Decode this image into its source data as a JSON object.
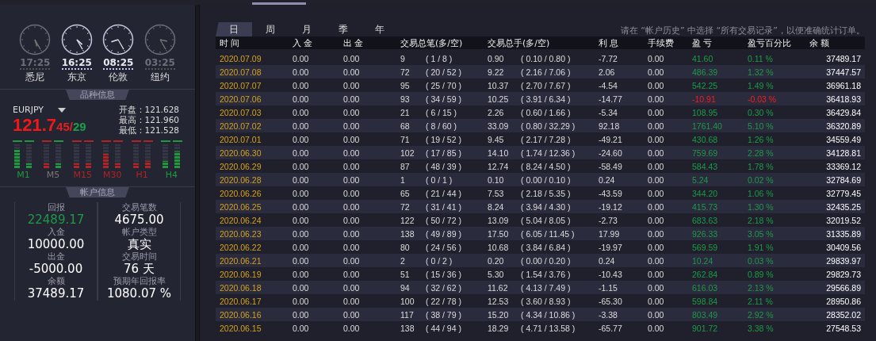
{
  "clocks": [
    {
      "time": "17:25",
      "city": "悉尼",
      "active": false
    },
    {
      "time": "16:25",
      "city": "东京",
      "active": true
    },
    {
      "time": "08:25",
      "city": "伦敦",
      "active": true
    },
    {
      "time": "03:25",
      "city": "纽约",
      "active": false
    }
  ],
  "symbol_panel": {
    "title": "品种信息",
    "symbol": "EURJPY",
    "price_big": "121.7",
    "bid_pips": "45",
    "separator": "/",
    "ask_pips": "29",
    "stats": [
      {
        "label": "开盘：",
        "value": "121.628"
      },
      {
        "label": "最高：",
        "value": "121.960"
      },
      {
        "label": "最低：",
        "value": "121.528"
      }
    ],
    "timeframes": [
      {
        "label": "M1",
        "color": "#1e9a3c",
        "bars": [
          {
            "level": 0.8,
            "color": "#1e9a3c"
          },
          {
            "level": 0.2,
            "color": "#1e9a3c"
          }
        ]
      },
      {
        "label": "M5",
        "color": "#777777",
        "bars": [
          {
            "level": 0.2,
            "color": "#b02424"
          },
          {
            "level": 0.2,
            "color": "#1e9a3c"
          }
        ]
      },
      {
        "label": "M15",
        "color": "#b02424",
        "bars": [
          {
            "level": 0.2,
            "color": "#b02424"
          },
          {
            "level": 0.2,
            "color": "#b02424"
          }
        ]
      },
      {
        "label": "M30",
        "color": "#b02424",
        "bars": [
          {
            "level": 0.6,
            "color": "#b02424"
          },
          {
            "level": 0.2,
            "color": "#b02424"
          }
        ]
      },
      {
        "label": "H1",
        "color": "#b02424",
        "bars": [
          {
            "level": 0.2,
            "color": "#b02424"
          },
          {
            "level": 0.3,
            "color": "#b02424"
          }
        ]
      },
      {
        "label": "H4",
        "color": "#1e9a3c",
        "bars": [
          {
            "level": 0.3,
            "color": "#1e9a3c"
          },
          {
            "level": 0.7,
            "color": "#1e9a3c"
          }
        ]
      }
    ]
  },
  "account_panel": {
    "title": "帐户信息",
    "left": [
      {
        "label": "回报",
        "value": "22489.17",
        "highlight": true
      },
      {
        "label": "入金",
        "value": "10000.00",
        "highlight": false
      },
      {
        "label": "出金",
        "value": "-5000.00",
        "highlight": false
      },
      {
        "label": "余额",
        "value": "37489.17",
        "highlight": false
      }
    ],
    "right": [
      {
        "label": "交易笔数",
        "value": "4675.00",
        "highlight": false
      },
      {
        "label": "帐户类型",
        "value": "真实",
        "highlight": false
      },
      {
        "label": "交易时间",
        "value": "76 天",
        "highlight": false
      },
      {
        "label": "预期年回报率",
        "value": "1080.07 %",
        "highlight": false
      }
    ]
  },
  "tabs": [
    {
      "label": "日",
      "selected": true
    },
    {
      "label": "周",
      "selected": false
    },
    {
      "label": "月",
      "selected": false
    },
    {
      "label": "季",
      "selected": false
    },
    {
      "label": "年",
      "selected": false
    }
  ],
  "note": "请在 “帐户历史” 中选择 “所有交易记录”，以便准确统计订单。",
  "table": {
    "columns": [
      "时 间",
      "入 金",
      "出 金",
      "交易总笔(多/空)",
      "交易总手(多/空)",
      "利 息",
      "手续费",
      "盈 亏",
      "盈亏百分比",
      "余 额"
    ],
    "rows": [
      {
        "date": "2020.07.09",
        "deposit": "0.00",
        "withdrawal": "0.00",
        "trades": "9",
        "trades_split": "( 1 / 8 )",
        "lots": "0.90",
        "lots_split": "( 0.10 / 0.80 )",
        "interest": "-7.72",
        "fee": "0.00",
        "profit": "41.60",
        "percent": "0.11 %",
        "balance": "37489.17",
        "loss": false
      },
      {
        "date": "2020.07.08",
        "deposit": "0.00",
        "withdrawal": "0.00",
        "trades": "72",
        "trades_split": "( 20 / 52 )",
        "lots": "9.22",
        "lots_split": "( 2.16 / 7.06 )",
        "interest": "2.06",
        "fee": "0.00",
        "profit": "486.39",
        "percent": "1.32 %",
        "balance": "37447.57",
        "loss": false
      },
      {
        "date": "2020.07.07",
        "deposit": "0.00",
        "withdrawal": "0.00",
        "trades": "95",
        "trades_split": "( 25 / 70 )",
        "lots": "10.37",
        "lots_split": "( 2.70 / 7.67 )",
        "interest": "-4.54",
        "fee": "0.00",
        "profit": "542.25",
        "percent": "1.49 %",
        "balance": "36961.18",
        "loss": false
      },
      {
        "date": "2020.07.06",
        "deposit": "0.00",
        "withdrawal": "0.00",
        "trades": "93",
        "trades_split": "( 34 / 59 )",
        "lots": "10.25",
        "lots_split": "( 3.91 / 6.34 )",
        "interest": "-14.77",
        "fee": "0.00",
        "profit": "-10.91",
        "percent": "-0.03 %",
        "balance": "36418.93",
        "loss": true
      },
      {
        "date": "2020.07.03",
        "deposit": "0.00",
        "withdrawal": "0.00",
        "trades": "21",
        "trades_split": "( 6 / 15 )",
        "lots": "2.26",
        "lots_split": "( 0.60 / 1.66 )",
        "interest": "-5.34",
        "fee": "0.00",
        "profit": "108.95",
        "percent": "0.30 %",
        "balance": "36429.84",
        "loss": false
      },
      {
        "date": "2020.07.02",
        "deposit": "0.00",
        "withdrawal": "0.00",
        "trades": "68",
        "trades_split": "( 8 / 60 )",
        "lots": "33.09",
        "lots_split": "( 0.80 / 32.29 )",
        "interest": "92.18",
        "fee": "0.00",
        "profit": "1761.40",
        "percent": "5.10 %",
        "balance": "36320.89",
        "loss": false
      },
      {
        "date": "2020.07.01",
        "deposit": "0.00",
        "withdrawal": "0.00",
        "trades": "71",
        "trades_split": "( 19 / 52 )",
        "lots": "9.45",
        "lots_split": "( 2.17 / 7.28 )",
        "interest": "-49.21",
        "fee": "0.00",
        "profit": "430.68",
        "percent": "1.26 %",
        "balance": "34559.49",
        "loss": false
      },
      {
        "date": "2020.06.30",
        "deposit": "0.00",
        "withdrawal": "0.00",
        "trades": "102",
        "trades_split": "( 17 / 85 )",
        "lots": "14.10",
        "lots_split": "( 1.74 / 12.36 )",
        "interest": "-24.60",
        "fee": "0.00",
        "profit": "759.69",
        "percent": "2.28 %",
        "balance": "34128.81",
        "loss": false
      },
      {
        "date": "2020.06.29",
        "deposit": "0.00",
        "withdrawal": "0.00",
        "trades": "87",
        "trades_split": "( 48 / 39 )",
        "lots": "12.74",
        "lots_split": "( 8.24 / 4.50 )",
        "interest": "-58.49",
        "fee": "0.00",
        "profit": "584.43",
        "percent": "1.78 %",
        "balance": "33369.12",
        "loss": false
      },
      {
        "date": "2020.06.28",
        "deposit": "0.00",
        "withdrawal": "0.00",
        "trades": "1",
        "trades_split": "( 0 / 1 )",
        "lots": "0.10",
        "lots_split": "( 0.00 / 0.10 )",
        "interest": "0.24",
        "fee": "0.00",
        "profit": "5.24",
        "percent": "0.02 %",
        "balance": "32784.69",
        "loss": false
      },
      {
        "date": "2020.06.26",
        "deposit": "0.00",
        "withdrawal": "0.00",
        "trades": "65",
        "trades_split": "( 21 / 44 )",
        "lots": "7.53",
        "lots_split": "( 2.18 / 5.35 )",
        "interest": "-43.59",
        "fee": "0.00",
        "profit": "344.20",
        "percent": "1.06 %",
        "balance": "32779.45",
        "loss": false
      },
      {
        "date": "2020.06.25",
        "deposit": "0.00",
        "withdrawal": "0.00",
        "trades": "72",
        "trades_split": "( 31 / 41 )",
        "lots": "8.24",
        "lots_split": "( 3.94 / 4.30 )",
        "interest": "-19.12",
        "fee": "0.00",
        "profit": "415.73",
        "percent": "1.30 %",
        "balance": "32435.25",
        "loss": false
      },
      {
        "date": "2020.06.24",
        "deposit": "0.00",
        "withdrawal": "0.00",
        "trades": "122",
        "trades_split": "( 50 / 72 )",
        "lots": "13.09",
        "lots_split": "( 5.04 / 8.05 )",
        "interest": "-2.73",
        "fee": "0.00",
        "profit": "683.63",
        "percent": "2.18 %",
        "balance": "32019.52",
        "loss": false
      },
      {
        "date": "2020.06.23",
        "deposit": "0.00",
        "withdrawal": "0.00",
        "trades": "138",
        "trades_split": "( 49 / 89 )",
        "lots": "17.50",
        "lots_split": "( 6.05 / 11.45 )",
        "interest": "17.99",
        "fee": "0.00",
        "profit": "926.33",
        "percent": "3.05 %",
        "balance": "31335.89",
        "loss": false
      },
      {
        "date": "2020.06.22",
        "deposit": "0.00",
        "withdrawal": "0.00",
        "trades": "80",
        "trades_split": "( 24 / 56 )",
        "lots": "10.68",
        "lots_split": "( 3.84 / 6.84 )",
        "interest": "-19.97",
        "fee": "0.00",
        "profit": "569.59",
        "percent": "1.91 %",
        "balance": "30409.56",
        "loss": false
      },
      {
        "date": "2020.06.21",
        "deposit": "0.00",
        "withdrawal": "0.00",
        "trades": "2",
        "trades_split": "( 0 / 2 )",
        "lots": "0.20",
        "lots_split": "( 0.00 / 0.20 )",
        "interest": "0.24",
        "fee": "0.00",
        "profit": "10.24",
        "percent": "0.03 %",
        "balance": "29839.97",
        "loss": false
      },
      {
        "date": "2020.06.19",
        "deposit": "0.00",
        "withdrawal": "0.00",
        "trades": "51",
        "trades_split": "( 15 / 36 )",
        "lots": "5.30",
        "lots_split": "( 1.54 / 3.76 )",
        "interest": "-10.43",
        "fee": "0.00",
        "profit": "262.84",
        "percent": "0.89 %",
        "balance": "29829.73",
        "loss": false
      },
      {
        "date": "2020.06.18",
        "deposit": "0.00",
        "withdrawal": "0.00",
        "trades": "94",
        "trades_split": "( 32 / 62 )",
        "lots": "11.62",
        "lots_split": "( 4.13 / 7.49 )",
        "interest": "-1.15",
        "fee": "0.00",
        "profit": "616.03",
        "percent": "2.13 %",
        "balance": "29566.89",
        "loss": false
      },
      {
        "date": "2020.06.17",
        "deposit": "0.00",
        "withdrawal": "0.00",
        "trades": "100",
        "trades_split": "( 22 / 78 )",
        "lots": "12.53",
        "lots_split": "( 3.60 / 8.93 )",
        "interest": "-65.30",
        "fee": "0.00",
        "profit": "598.84",
        "percent": "2.11 %",
        "balance": "28950.86",
        "loss": false
      },
      {
        "date": "2020.06.16",
        "deposit": "0.00",
        "withdrawal": "0.00",
        "trades": "117",
        "trades_split": "( 38 / 79 )",
        "lots": "15.20",
        "lots_split": "( 4.34 / 10.86 )",
        "interest": "-3.38",
        "fee": "0.00",
        "profit": "803.49",
        "percent": "2.92 %",
        "balance": "28352.02",
        "loss": false
      },
      {
        "date": "2020.06.15",
        "deposit": "0.00",
        "withdrawal": "0.00",
        "trades": "138",
        "trades_split": "( 44 / 94 )",
        "lots": "18.29",
        "lots_split": "( 4.71 / 13.58 )",
        "interest": "-65.77",
        "fee": "0.00",
        "profit": "901.72",
        "percent": "3.38 %",
        "balance": "27548.53",
        "loss": false
      }
    ]
  }
}
